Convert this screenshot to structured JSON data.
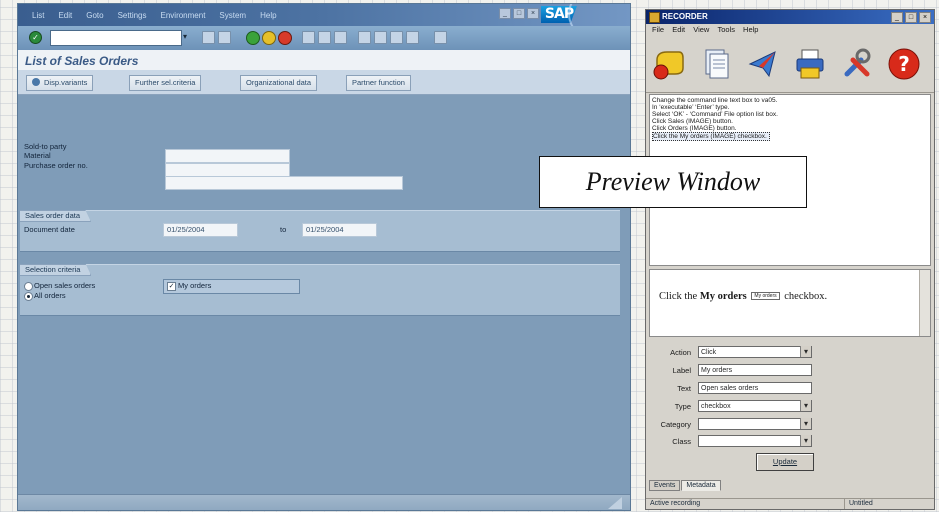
{
  "sap": {
    "menu": [
      "List",
      "Edit",
      "Goto",
      "Settings",
      "Environment",
      "System",
      "Help"
    ],
    "logo": "SAP",
    "title": "List of Sales Orders",
    "app_buttons": [
      "Disp.variants",
      "Further sel.criteria",
      "Organizational data",
      "Partner function"
    ],
    "fields": {
      "sold_to_label": "Sold-to party",
      "material_label": "Material",
      "po_label": "Purchase order no."
    },
    "sales_group": {
      "title": "Sales order data",
      "doc_date_label": "Document date",
      "date_from": "01/25/2004",
      "to_label": "to",
      "date_to": "01/25/2004"
    },
    "selection_group": {
      "title": "Selection criteria",
      "open_orders": "Open sales orders",
      "all_orders": "All orders",
      "my_orders": "My orders"
    }
  },
  "preview_label": "Preview Window",
  "recorder": {
    "title": "RECORDER",
    "menu": [
      "File",
      "Edit",
      "View",
      "Tools",
      "Help"
    ],
    "icons": [
      "record-icon",
      "document-icon",
      "send-icon",
      "print-icon",
      "tools-icon",
      "help-icon"
    ],
    "steps": [
      "Change the command line text box to va05.",
      "In ‘executable’ ‘Enter’ type.",
      "Select ‘OK’ - ‘Command’ File option list box.",
      "Click Sales (IMAGE) button.",
      "Click Orders (IMAGE) button.",
      "Click the My orders (IMAGE) checkbox."
    ],
    "preview": {
      "before": "Click the ",
      "bold": "My orders",
      "mini": "My orders",
      "after": " checkbox."
    },
    "props": {
      "action_label": "Action",
      "action_value": "Click",
      "label_label": "Label",
      "label_value": "My orders",
      "text_label": "Text",
      "text_value": "Open sales orders",
      "type_label": "Type",
      "type_value": "checkbox",
      "category_label": "Category",
      "category_value": "",
      "class_label": "Class",
      "class_value": ""
    },
    "update": "Update",
    "tabs": [
      "Events",
      "Metadata"
    ],
    "status_left": "Active recording",
    "status_right": "Untitled"
  }
}
